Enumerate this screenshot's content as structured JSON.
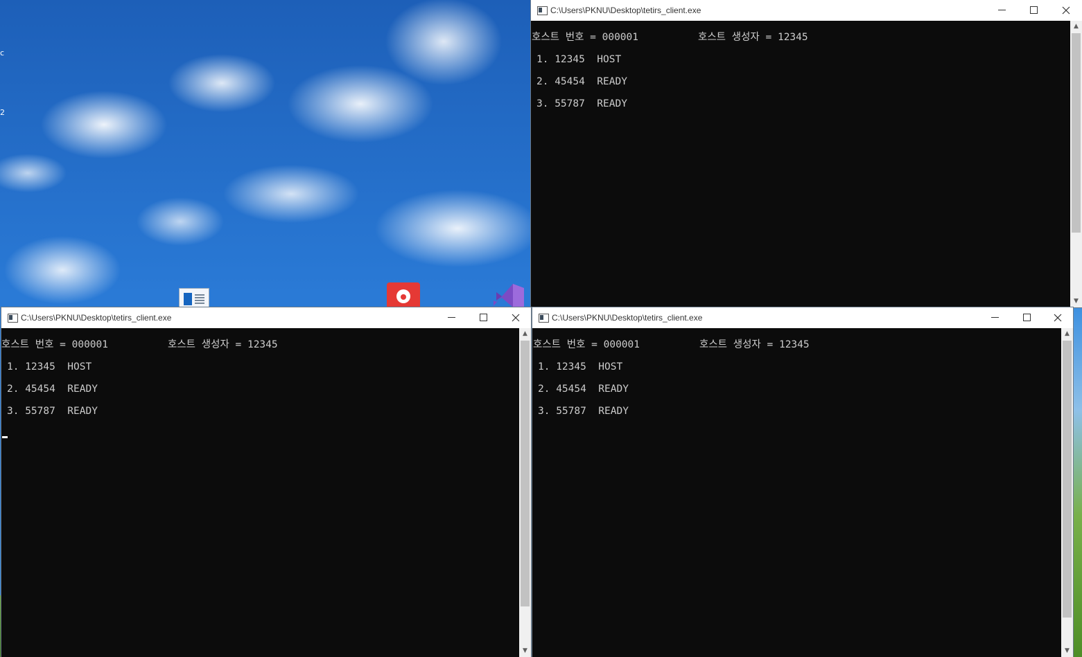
{
  "desktop": {
    "edge_text": [
      "c",
      "2"
    ],
    "icons": [
      "document-icon",
      "bug-app-icon",
      "visual-studio-icon"
    ]
  },
  "windows": [
    {
      "id": "top-right",
      "title": "C:\\Users\\PKNU\\Desktop\\tetirs_client.exe",
      "header_left": "호스트 번호 = 000001",
      "header_right": "호스트 생성자 = 12345",
      "rows": [
        "1. 12345  HOST",
        "2. 45454  READY",
        "3. 55787  READY"
      ]
    },
    {
      "id": "bottom-left",
      "title": "C:\\Users\\PKNU\\Desktop\\tetirs_client.exe",
      "header_left": "호스트 번호 = 000001",
      "header_right": "호스트 생성자 = 12345",
      "rows": [
        "1. 12345  HOST",
        "2. 45454  READY",
        "3. 55787  READY"
      ]
    },
    {
      "id": "bottom-right",
      "title": "C:\\Users\\PKNU\\Desktop\\tetirs_client.exe",
      "header_left": "호스트 번호 = 000001",
      "header_right": "호스트 생성자 = 12345",
      "rows": [
        "1. 12345  HOST",
        "2. 45454  READY",
        "3. 55787  READY"
      ]
    }
  ],
  "colors": {
    "console_bg": "#0c0c0c",
    "console_text": "#cccccc",
    "titlebar_bg": "#ffffff"
  }
}
